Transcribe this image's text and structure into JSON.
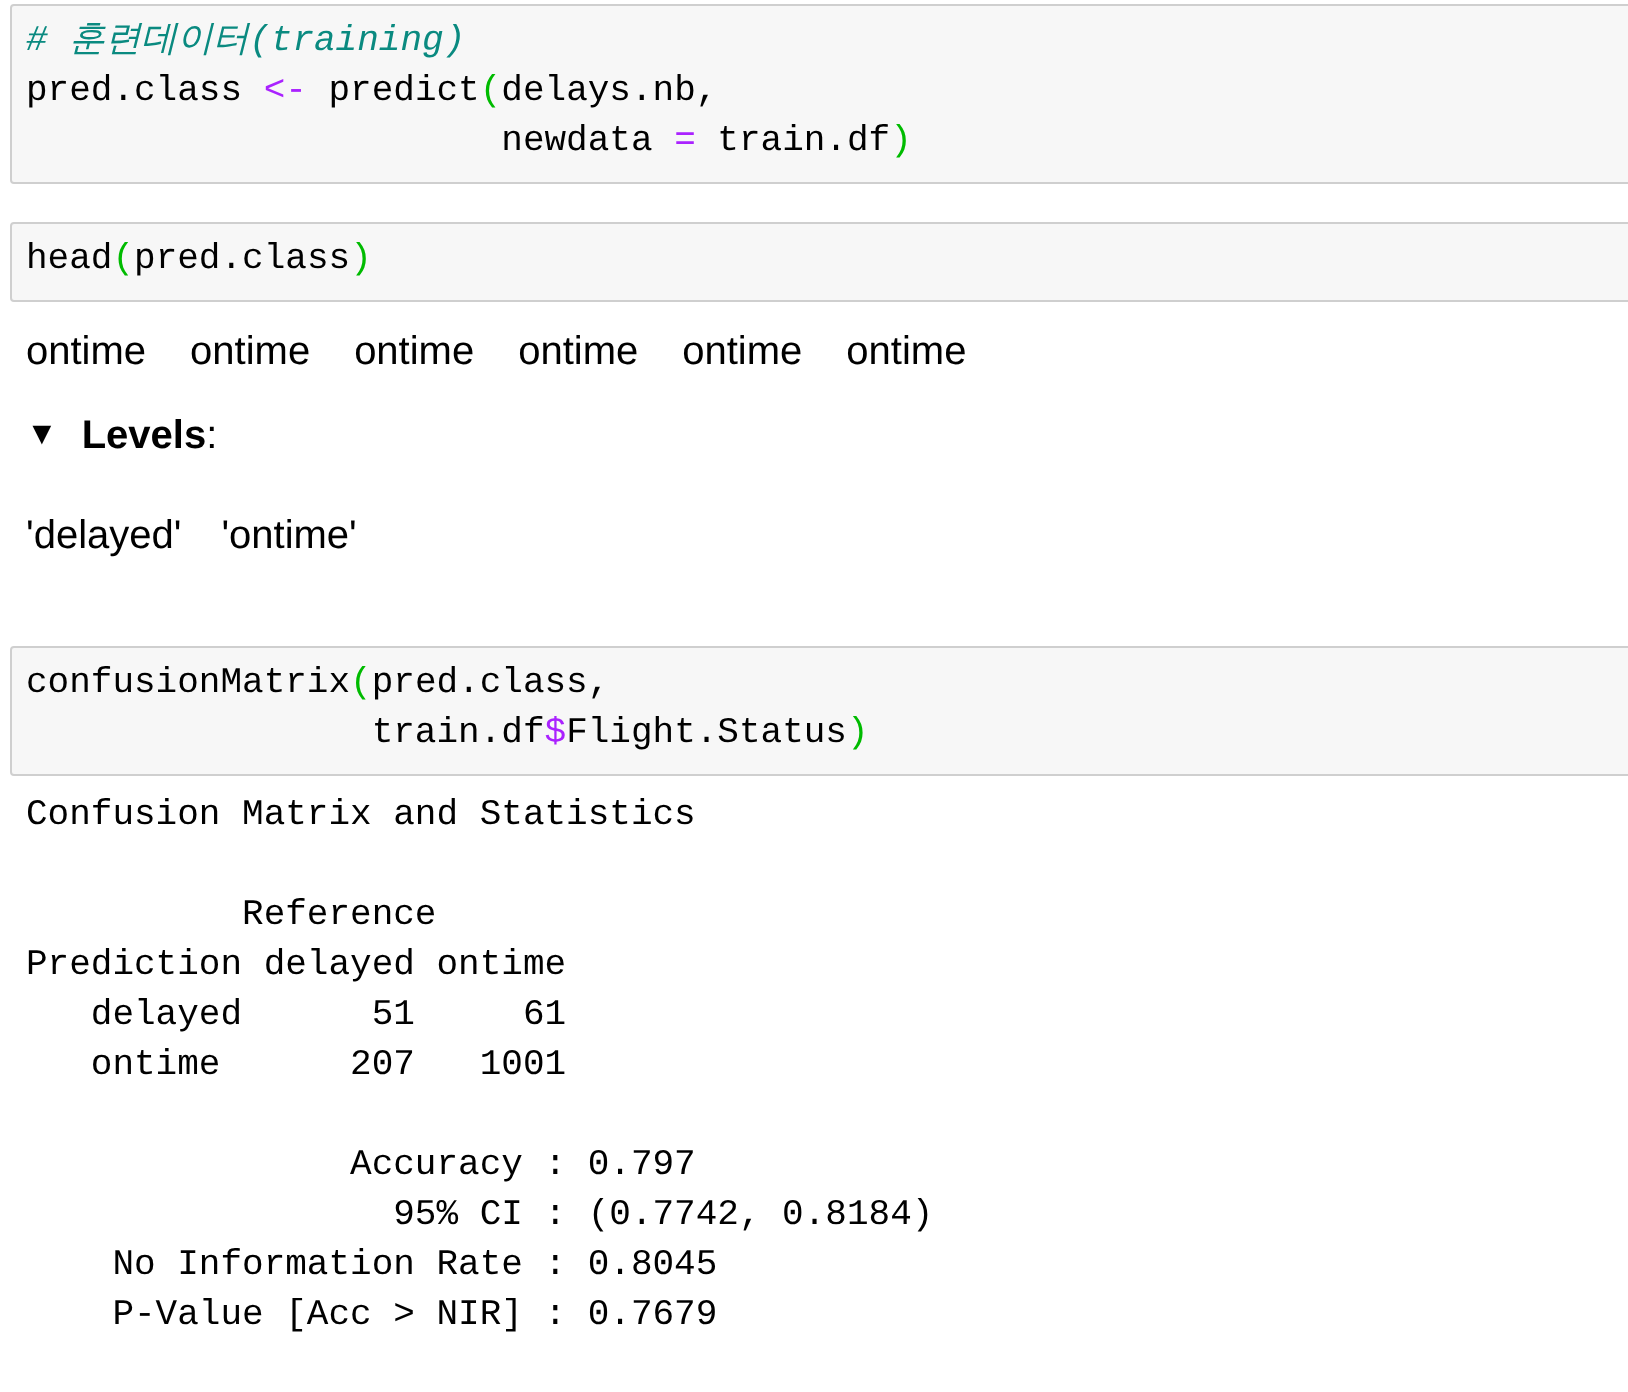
{
  "cells": [
    {
      "kind": "code",
      "lines": [
        [
          {
            "kind": "comment",
            "text": "# 훈련데이터(training)"
          }
        ],
        [
          {
            "kind": "plain",
            "text": "pred.class "
          },
          {
            "kind": "operator",
            "text": "<-"
          },
          {
            "kind": "plain",
            "text": " predict"
          },
          {
            "kind": "bracket",
            "text": "("
          },
          {
            "kind": "plain",
            "text": "delays.nb,"
          }
        ],
        [
          {
            "kind": "plain",
            "text": "                      newdata "
          },
          {
            "kind": "operator",
            "text": "="
          },
          {
            "kind": "plain",
            "text": " train.df"
          },
          {
            "kind": "bracket",
            "text": ")"
          }
        ]
      ]
    },
    {
      "kind": "code",
      "lines": [
        [
          {
            "kind": "plain",
            "text": "head"
          },
          {
            "kind": "bracket",
            "text": "("
          },
          {
            "kind": "plain",
            "text": "pred.class"
          },
          {
            "kind": "bracket",
            "text": ")"
          }
        ]
      ]
    },
    {
      "kind": "vector",
      "items": [
        "ontime",
        "ontime",
        "ontime",
        "ontime",
        "ontime",
        "ontime"
      ]
    },
    {
      "kind": "levels",
      "toggle": "▼",
      "label": "**Levels**:",
      "expanded": true,
      "items": [
        "'delayed'",
        "'ontime'"
      ]
    },
    {
      "kind": "code",
      "lines": [
        [
          {
            "kind": "plain",
            "text": "confusionMatrix"
          },
          {
            "kind": "bracket",
            "text": "("
          },
          {
            "kind": "plain",
            "text": "pred.class,"
          }
        ],
        [
          {
            "kind": "plain",
            "text": "                train.df"
          },
          {
            "kind": "operator",
            "text": "$"
          },
          {
            "kind": "plain",
            "text": "Flight.Status"
          },
          {
            "kind": "bracket",
            "text": ")"
          }
        ]
      ]
    },
    {
      "kind": "text",
      "blocks": [
        [
          "Confusion Matrix and Statistics"
        ],
        [
          "          Reference",
          "Prediction delayed ontime",
          "   delayed      51     61",
          "   ontime      207   1001"
        ],
        [
          "               Accuracy : 0.797",
          "                 95% CI : (0.7742, 0.8184)",
          "    No Information Rate : 0.8045",
          "    P-Value [Acc > NIR] : 0.7679"
        ]
      ]
    }
  ]
}
